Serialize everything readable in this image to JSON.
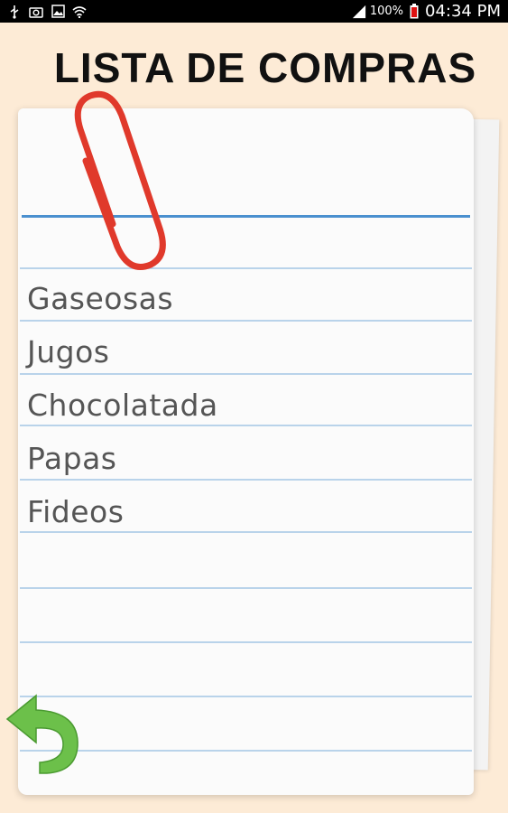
{
  "status_bar": {
    "left_icons": [
      "usb-icon",
      "camera-icon",
      "image-icon",
      "wifi-icon"
    ],
    "signal_icon": "signal-icon",
    "battery_pct": "100%",
    "battery_icon": "battery-icon",
    "time": "04:34 PM"
  },
  "header": {
    "title": "LISTA DE COMPRAS"
  },
  "list": {
    "items": [
      "Gaseosas",
      "Jugos",
      "Chocolatada",
      "Papas",
      "Fideos"
    ]
  },
  "colors": {
    "background": "#fdebd6",
    "paper": "#fbfbfb",
    "rule_line": "#b9d3ea",
    "top_line": "#4a90cf",
    "clip": "#e0392b",
    "back_arrow": "#6cc04a"
  },
  "icons": {
    "clip": "paperclip-icon",
    "back": "back-arrow-icon"
  }
}
